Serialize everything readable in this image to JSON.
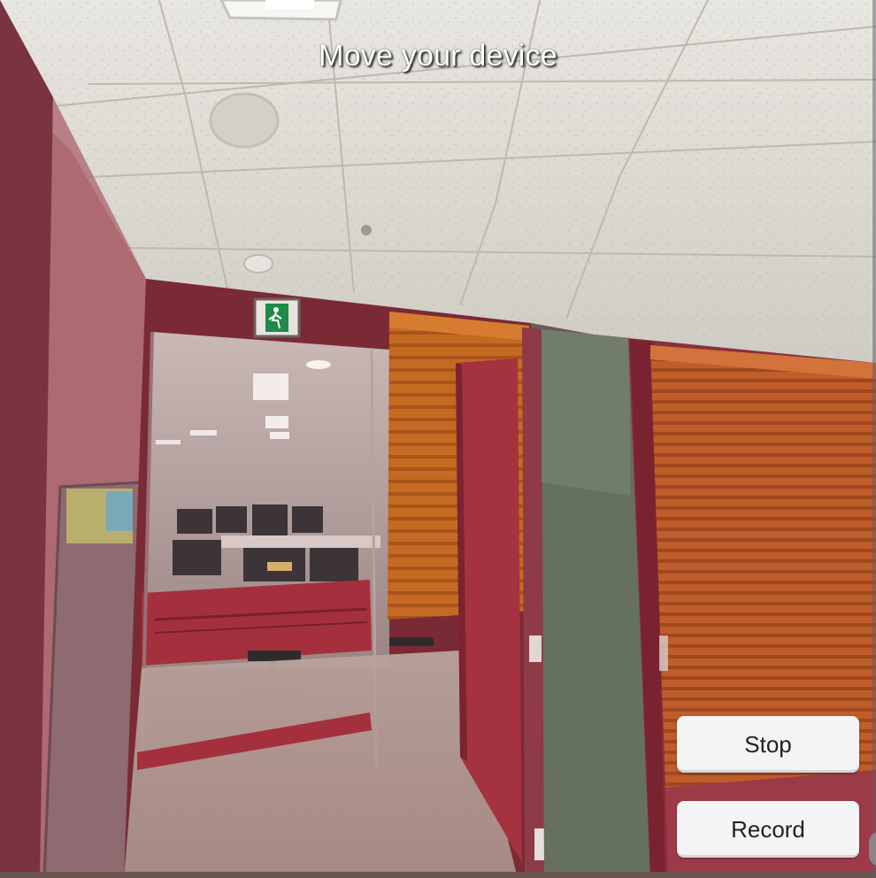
{
  "overlay": {
    "instruction": "Move your device"
  },
  "controls": {
    "stop_label": "Stop",
    "record_label": "Record"
  },
  "scene": {
    "exit_sign_icon": "emergency-exit-icon",
    "colors": {
      "ceiling": "#d8d6cf",
      "segmentation_wall": "#8c2a36",
      "segmentation_blind": "#c2641f",
      "door_frame": "#7a2330",
      "floor": "#a58d86",
      "pillar": "#66705f"
    }
  }
}
